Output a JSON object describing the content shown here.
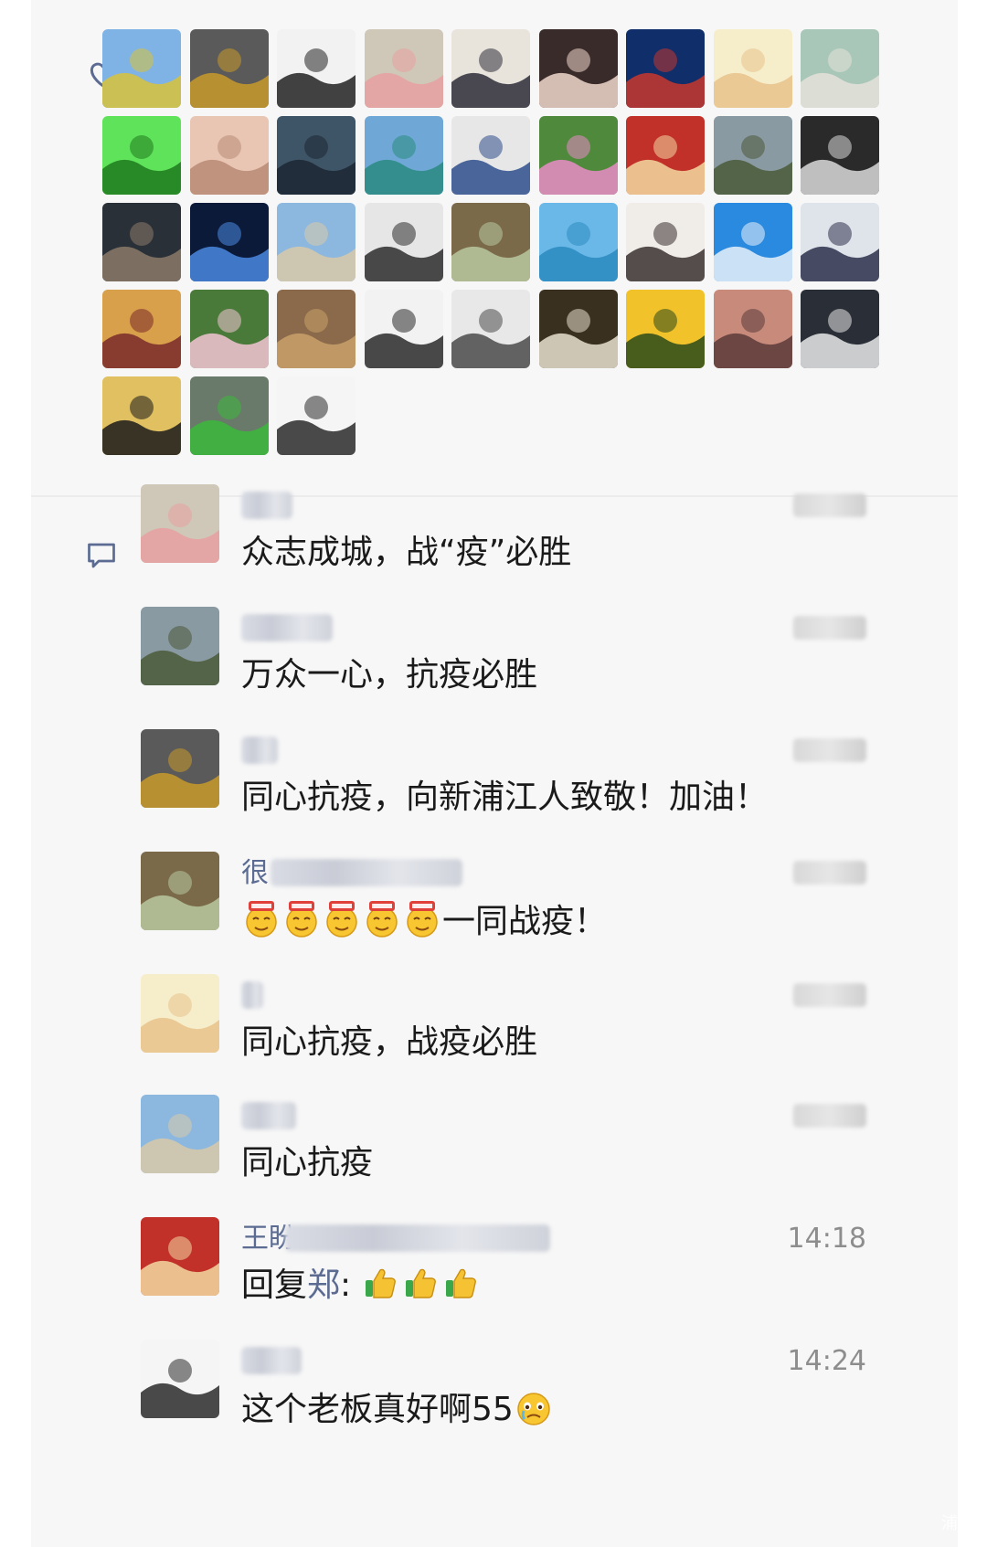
{
  "likes": {
    "icon": "heart-icon",
    "avatars": [
      {
        "label": "landscape-field",
        "colors": [
          "#7fb3e6",
          "#d8c23a"
        ]
      },
      {
        "label": "robot-statue",
        "colors": [
          "#5a5a5a",
          "#c89a2a"
        ]
      },
      {
        "label": "calligraphy-warrior",
        "colors": [
          "#f2f2f2",
          "#222222"
        ]
      },
      {
        "label": "cartoon-cat",
        "colors": [
          "#cfc7b8",
          "#e8a0a0"
        ]
      },
      {
        "label": "anime-boy",
        "colors": [
          "#e8e4dc",
          "#2d2d38"
        ]
      },
      {
        "label": "baby-photo",
        "colors": [
          "#3a2b2b",
          "#f0d8cc"
        ]
      },
      {
        "label": "seaside-person",
        "colors": [
          "#0f2e6a",
          "#c8362c"
        ]
      },
      {
        "label": "cartoon-child",
        "colors": [
          "#f6eecb",
          "#e8c28c"
        ]
      },
      {
        "label": "fishing-scene",
        "colors": [
          "#a9c7b9",
          "#e5e1d8"
        ]
      },
      {
        "label": "green-smiley",
        "colors": [
          "#5fe35a",
          "#1f7a1d"
        ]
      },
      {
        "label": "toddler-face",
        "colors": [
          "#e9c6b3",
          "#b88a74"
        ]
      },
      {
        "label": "hooded-figure",
        "colors": [
          "#3e5567",
          "#1c2733"
        ]
      },
      {
        "label": "lake-mountain",
        "colors": [
          "#6fa8d6",
          "#2a8a80"
        ]
      },
      {
        "label": "man-portrait",
        "colors": [
          "#e7e7e7",
          "#2e4d8c"
        ]
      },
      {
        "label": "lotus-flower",
        "colors": [
          "#4f8a3c",
          "#e98bc6"
        ]
      },
      {
        "label": "ceremony-stage",
        "colors": [
          "#c2302a",
          "#f2d9a0"
        ]
      },
      {
        "label": "cycling-mountains",
        "colors": [
          "#8a9aa2",
          "#4a5a3a"
        ]
      },
      {
        "label": "man-glasses",
        "colors": [
          "#2a2a2a",
          "#d9d9d9"
        ]
      },
      {
        "label": "city-night",
        "colors": [
          "#2a3038",
          "#8b7a6a"
        ]
      },
      {
        "label": "night-lights",
        "colors": [
          "#0c1a3a",
          "#4a8ae0"
        ]
      },
      {
        "label": "beach-walker",
        "colors": [
          "#8cb8e0",
          "#d8c8a8"
        ]
      },
      {
        "label": "cartoon-man",
        "colors": [
          "#e6e6e6",
          "#2b2b2b"
        ]
      },
      {
        "label": "frog-figure",
        "colors": [
          "#7a6a4a",
          "#b8c8a0"
        ]
      },
      {
        "label": "golden-gate",
        "colors": [
          "#6ab8e8",
          "#2a8ac0"
        ]
      },
      {
        "label": "smiling-woman",
        "colors": [
          "#f0ece8",
          "#3a3030"
        ]
      },
      {
        "label": "dandelion",
        "colors": [
          "#2a8ae0",
          "#e8f0f8"
        ]
      },
      {
        "label": "anime-girl",
        "colors": [
          "#dfe4ea",
          "#2b2f4a"
        ]
      },
      {
        "label": "woman-portrait",
        "colors": [
          "#d8a04a",
          "#7a2a2a"
        ]
      },
      {
        "label": "pink-flower",
        "colors": [
          "#4a7a3a",
          "#f2c4d4"
        ]
      },
      {
        "label": "dog-shop",
        "colors": [
          "#8a6a4a",
          "#c8a06a"
        ]
      },
      {
        "label": "white-smile",
        "colors": [
          "#f2f2f2",
          "#2a2a2a"
        ]
      },
      {
        "label": "sketch-object",
        "colors": [
          "#e8e8e8",
          "#4a4a4a"
        ]
      },
      {
        "label": "tunnel-walkway",
        "colors": [
          "#3a3020",
          "#e8e0d0"
        ]
      },
      {
        "label": "sunflower",
        "colors": [
          "#f2c22a",
          "#2a4a1a"
        ]
      },
      {
        "label": "store-interior",
        "colors": [
          "#c88a7a",
          "#5a3a3a"
        ]
      },
      {
        "label": "panda-game",
        "colors": [
          "#2a2e36",
          "#e8e8e8"
        ]
      },
      {
        "label": "yoga-pose",
        "colors": [
          "#e0c060",
          "#1a1a1a"
        ]
      },
      {
        "label": "tea-cup",
        "colors": [
          "#6a7a6a",
          "#3ab83a"
        ]
      },
      {
        "label": "girl-pear",
        "colors": [
          "#f5f5f5",
          "#2a2a2a"
        ]
      }
    ]
  },
  "comments_section": {
    "icon": "comment-icon",
    "items": [
      {
        "name": "",
        "time": "",
        "text": "众志成城，战“疫”必胜",
        "avatar": "cartoon-cat"
      },
      {
        "name": "",
        "time": "",
        "text": "万众一心，抗疫必胜",
        "avatar": "cycling-mountains"
      },
      {
        "name": "",
        "time": "",
        "text": "同心抗疫，向新浦江人致敬！加油！",
        "avatar": "robot-statue"
      },
      {
        "name": "很",
        "time": "",
        "text": "一同战疫！",
        "avatar": "frog-figure",
        "emoji": "666-emoji",
        "emoji_count": 5
      },
      {
        "name": "",
        "time": "",
        "text": "同心抗疫，战疫必胜",
        "avatar": "cartoon-child"
      },
      {
        "name": "",
        "time": "",
        "text": "同心抗疫",
        "avatar": "beach-walker"
      },
      {
        "name": "王盼",
        "time": "14:18",
        "reply_prefix": "回复",
        "reply_to": "郑",
        "reply_suffix": ":",
        "avatar": "ceremony-stage",
        "emoji": "thumbs-up-emoji",
        "emoji_count": 3
      },
      {
        "name": "",
        "time": "14:24",
        "text": "这个老板真好啊55",
        "avatar": "girl-pear",
        "emoji": "crying-emoji",
        "emoji_count": 1
      }
    ]
  },
  "watermark": "浦江"
}
